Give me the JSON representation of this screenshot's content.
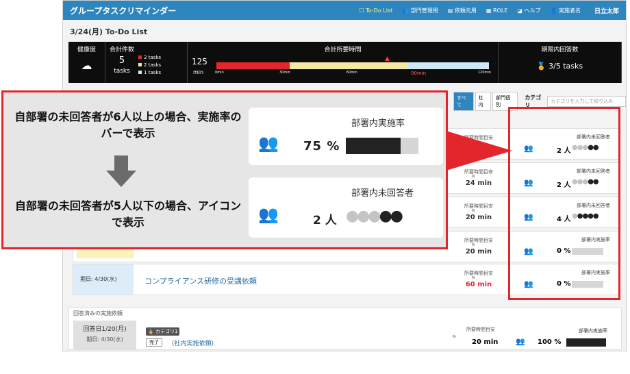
{
  "app": {
    "title": "グループタスクリマインダー",
    "nav": [
      "To-Do List",
      "部門管理用",
      "依頼元用",
      "ROLE",
      "ヘルプ",
      "実施者名"
    ],
    "user": "日立太郎",
    "page_heading": "3/24(月) To-Do List"
  },
  "summary": {
    "health_label": "健康度",
    "health_icon": "cloud-icon",
    "total_label": "合計件数",
    "total_value": "5",
    "total_unit": "tasks",
    "legend": [
      "2 tasks",
      "2 tasks",
      "1 tasks"
    ],
    "legend_colors": [
      "#e3262b",
      "#f3e9a0",
      "#cfe6f7"
    ],
    "time_label": "合計所要時間",
    "time_value": "125",
    "time_unit": "min",
    "ticks": [
      "0min",
      "30min",
      "60min",
      "90min",
      "120min"
    ],
    "overdue_label": "期限内回答数",
    "overdue_value": "3/5 tasks"
  },
  "filter": {
    "tabs": [
      "すべて",
      "社内",
      "部門個別"
    ],
    "category_label": "カテゴリ",
    "category_placeholder": "カテゴリを入力して絞り込み"
  },
  "rows": [
    {
      "time_label": "所要時間目安",
      "time": "",
      "stat_label": "部署内未回答者",
      "count": "2 人"
    },
    {
      "time_label": "所要時間目安",
      "time": "24 min",
      "stat_label": "部署内未回答者",
      "count": "2 人"
    },
    {
      "time_label": "所要時間目安",
      "time": "20 min",
      "stat_label": "部署内未回答者",
      "count": "4 人"
    },
    {
      "time_label": "所要時間目安",
      "time": "20 min",
      "stat_label": "部署内実施率",
      "count": "0 %"
    },
    {
      "time_label": "所要時間目安",
      "time": "60 min",
      "stat_label": "部署内実施率",
      "count": "0 %",
      "deadline": "期日: 4/30(水)",
      "title": "コンプライアンス研修の受講依頼"
    }
  ],
  "answered": {
    "section_label": "回答済みの実施依頼",
    "answer_date": "回答日1/20(月)",
    "deadline": "期日: 4/30(水)",
    "category": "カテゴリ1",
    "status": "完了",
    "title": "(社内実施依頼)",
    "time_label": "所要時間目安",
    "time": "20 min",
    "stat_label": "部署内実施率",
    "percent": "100 %"
  },
  "callout": {
    "text_top": "自部署の未回答者が6人以上の場合、実施率のバーで表示",
    "text_bottom": "自部署の未回答者が5人以下の場合、アイコンで表示",
    "card1_label": "部署内実施率",
    "card1_value": "75 %",
    "card1_rate": 75,
    "card2_label": "部署内未回答者",
    "card2_value": "2 人"
  }
}
